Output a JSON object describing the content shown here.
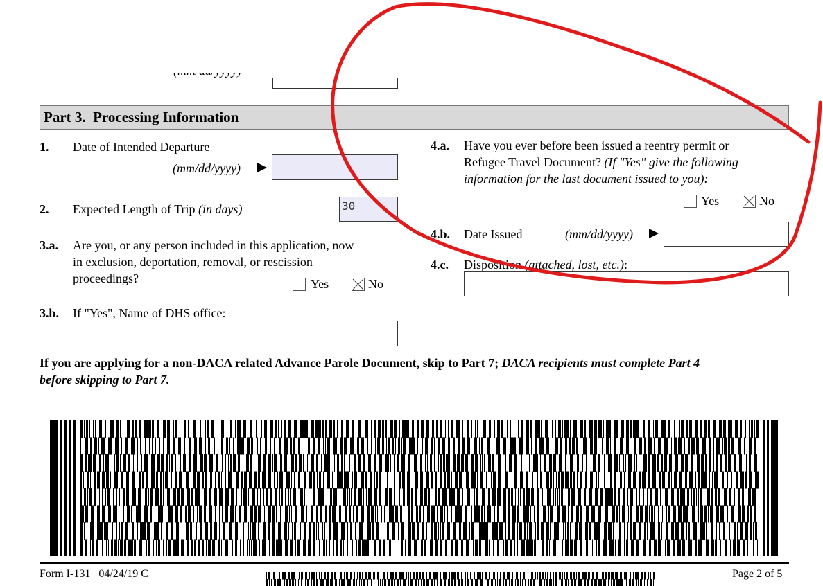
{
  "part3": {
    "header": "Part 3.  Processing Information",
    "q1": {
      "num": "1.",
      "label": "Date of Intended Departure",
      "hint": "(mm/dd/yyyy)",
      "value": ""
    },
    "q2": {
      "num": "2.",
      "label": "Expected Length of Trip",
      "hint": "(in days)",
      "value": "30"
    },
    "q3a": {
      "num": "3.a.",
      "lines": [
        "Are you, or any person included in this application, now",
        "in exclusion, deportation, removal, or rescission",
        "proceedings?"
      ],
      "yes": "Yes",
      "no": "No",
      "selected": "No"
    },
    "q3b": {
      "num": "3.b.",
      "label": "If \"Yes\", Name of DHS office:",
      "value": ""
    },
    "q4a": {
      "num": "4.a.",
      "line1": "Have you ever before been issued a reentry permit or",
      "line2_plain": "Refugee Travel Document?",
      "line2_italic": " (If \"Yes\" give the following",
      "line3": "information for the last document issued to you):",
      "yes": "Yes",
      "no": "No",
      "selected": "No"
    },
    "q4b": {
      "num": "4.b.",
      "label": "Date Issued",
      "hint": "(mm/dd/yyyy)",
      "value": ""
    },
    "q4c": {
      "num": "4.c.",
      "label": "Disposition",
      "hint": "(attached, lost, etc.)",
      "suffix": ":",
      "value": ""
    }
  },
  "instruction": {
    "bold": "If you are applying for a non-DACA related Advance Parole Document, skip to Part 7; ",
    "bold_italic1": "DACA recipients must complete Part 4",
    "bold_italic2": "before skipping to Part 7."
  },
  "footer": {
    "form_id": "Form I-131   04/24/19 C",
    "page": "Page 2 of 5"
  },
  "annotation_color": "#e01b1b"
}
